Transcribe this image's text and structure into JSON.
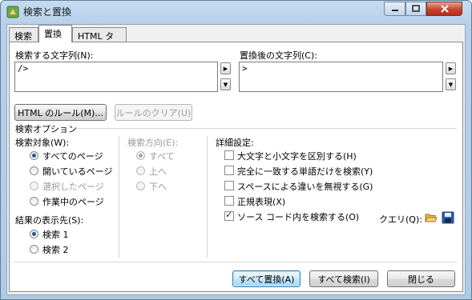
{
  "window": {
    "title": "検索と置換"
  },
  "tabs": [
    {
      "label": "検索",
      "active": false
    },
    {
      "label": "置換",
      "active": true
    },
    {
      "label": "HTML タグ",
      "active": false
    }
  ],
  "find": {
    "label": "検索する文字列(N):",
    "value": "/>"
  },
  "replace": {
    "label": "置換後の文字列(C):",
    "value": ">"
  },
  "buttons": {
    "html_rules": "HTML のルール(M)...",
    "clear_rules": "ルールのクリア(U)",
    "replace_all": "すべて置換(A)",
    "find_all": "すべて検索(I)",
    "close": "閉じる"
  },
  "options": {
    "title": "検索オプション",
    "target": {
      "title": "検索対象(W):",
      "items": [
        {
          "label": "すべてのページ",
          "checked": true,
          "enabled": true
        },
        {
          "label": "開いているページ",
          "checked": false,
          "enabled": true
        },
        {
          "label": "選択したページ",
          "checked": false,
          "enabled": false
        },
        {
          "label": "作業中のページ",
          "checked": false,
          "enabled": true
        }
      ]
    },
    "direction": {
      "title": "検索方向(E):",
      "items": [
        {
          "label": "すべて",
          "checked": true
        },
        {
          "label": "上へ",
          "checked": false
        },
        {
          "label": "下へ",
          "checked": false
        }
      ]
    },
    "results": {
      "title": "結果の表示先(S):",
      "items": [
        {
          "label": "検索 1",
          "checked": true
        },
        {
          "label": "検索 2",
          "checked": false
        }
      ]
    },
    "advanced": {
      "title": "詳細設定:",
      "items": [
        {
          "label": "大文字と小文字を区別する(H)",
          "checked": false
        },
        {
          "label": "完全に一致する単語だけを検索(Y)",
          "checked": false
        },
        {
          "label": "スペースによる違いを無視する(G)",
          "checked": false
        },
        {
          "label": "正規表現(X)",
          "checked": false
        },
        {
          "label": "ソース コード内を検索する(O)",
          "checked": true
        }
      ]
    },
    "query_label": "クエリ(Q):"
  },
  "icons": {
    "open": "folder-open-icon",
    "save": "floppy-disk-icon"
  },
  "colors": {
    "title_bar": "#b9d1ea",
    "close_button": "#c7442d",
    "accent": "#3c7fb1"
  }
}
